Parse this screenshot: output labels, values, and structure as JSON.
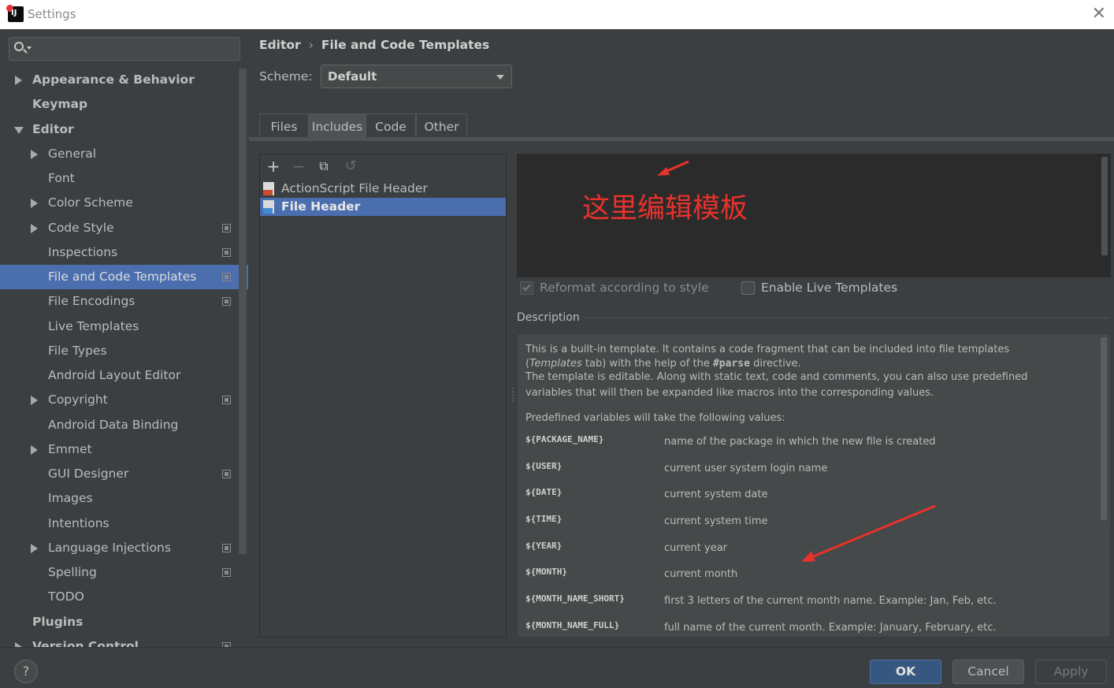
{
  "window": {
    "title": "Settings"
  },
  "search": {
    "placeholder": ""
  },
  "sidebar": {
    "items": [
      {
        "label": "Appearance & Behavior"
      },
      {
        "label": "Keymap"
      },
      {
        "label": "Editor"
      },
      {
        "label": "General"
      },
      {
        "label": "Font"
      },
      {
        "label": "Color Scheme"
      },
      {
        "label": "Code Style"
      },
      {
        "label": "Inspections"
      },
      {
        "label": "File and Code Templates"
      },
      {
        "label": "File Encodings"
      },
      {
        "label": "Live Templates"
      },
      {
        "label": "File Types"
      },
      {
        "label": "Android Layout Editor"
      },
      {
        "label": "Copyright"
      },
      {
        "label": "Android Data Binding"
      },
      {
        "label": "Emmet"
      },
      {
        "label": "GUI Designer"
      },
      {
        "label": "Images"
      },
      {
        "label": "Intentions"
      },
      {
        "label": "Language Injections"
      },
      {
        "label": "Spelling"
      },
      {
        "label": "TODO"
      },
      {
        "label": "Plugins"
      },
      {
        "label": "Version Control"
      }
    ]
  },
  "breadcrumb": {
    "parent": "Editor",
    "current": "File and Code Templates"
  },
  "scheme": {
    "label": "Scheme:",
    "value": "Default"
  },
  "tabs": [
    {
      "label": "Files"
    },
    {
      "label": "Includes"
    },
    {
      "label": "Code"
    },
    {
      "label": "Other"
    }
  ],
  "toolbar": {
    "add": "+",
    "remove": "−",
    "copy": "⧉",
    "reset": "↺"
  },
  "templates": [
    {
      "label": "ActionScript File Header",
      "tag": "AS"
    },
    {
      "label": "File Header",
      "tag": "J"
    }
  ],
  "annotation": {
    "text": "这里编辑模板"
  },
  "options": {
    "reformat": "Reformat according to style",
    "live": "Enable Live Templates"
  },
  "description": {
    "label": "Description",
    "line1": "This is a built-in template. It contains a code fragment that can be included into file templates",
    "line2a": "(",
    "line2b": "Templates",
    "line2c": " tab) with the help of the ",
    "line2d": "#parse",
    "line2e": " directive.",
    "line3": "The template is editable. Along with static text, code and comments, you can also use predefined",
    "line4": "variables that will then be expanded like macros into the corresponding values.",
    "line5": "Predefined variables will take the following values:",
    "vars": [
      {
        "name": "${PACKAGE_NAME}",
        "desc": "name of the package in which the new file is created"
      },
      {
        "name": "${USER}",
        "desc": "current user system login name"
      },
      {
        "name": "${DATE}",
        "desc": "current system date"
      },
      {
        "name": "${TIME}",
        "desc": "current system time"
      },
      {
        "name": "${YEAR}",
        "desc": "current year"
      },
      {
        "name": "${MONTH}",
        "desc": "current month"
      },
      {
        "name": "${MONTH_NAME_SHORT}",
        "desc": "first 3 letters of the current month name. Example: Jan, Feb, etc."
      },
      {
        "name": "${MONTH_NAME_FULL}",
        "desc": "full name of the current month. Example: January, February, etc."
      }
    ]
  },
  "buttons": {
    "help": "?",
    "ok": "OK",
    "cancel": "Cancel",
    "apply": "Apply"
  },
  "colors": {
    "accent": "#4b6eaf",
    "annotation": "#e8322c",
    "primary_button": "#365880"
  }
}
